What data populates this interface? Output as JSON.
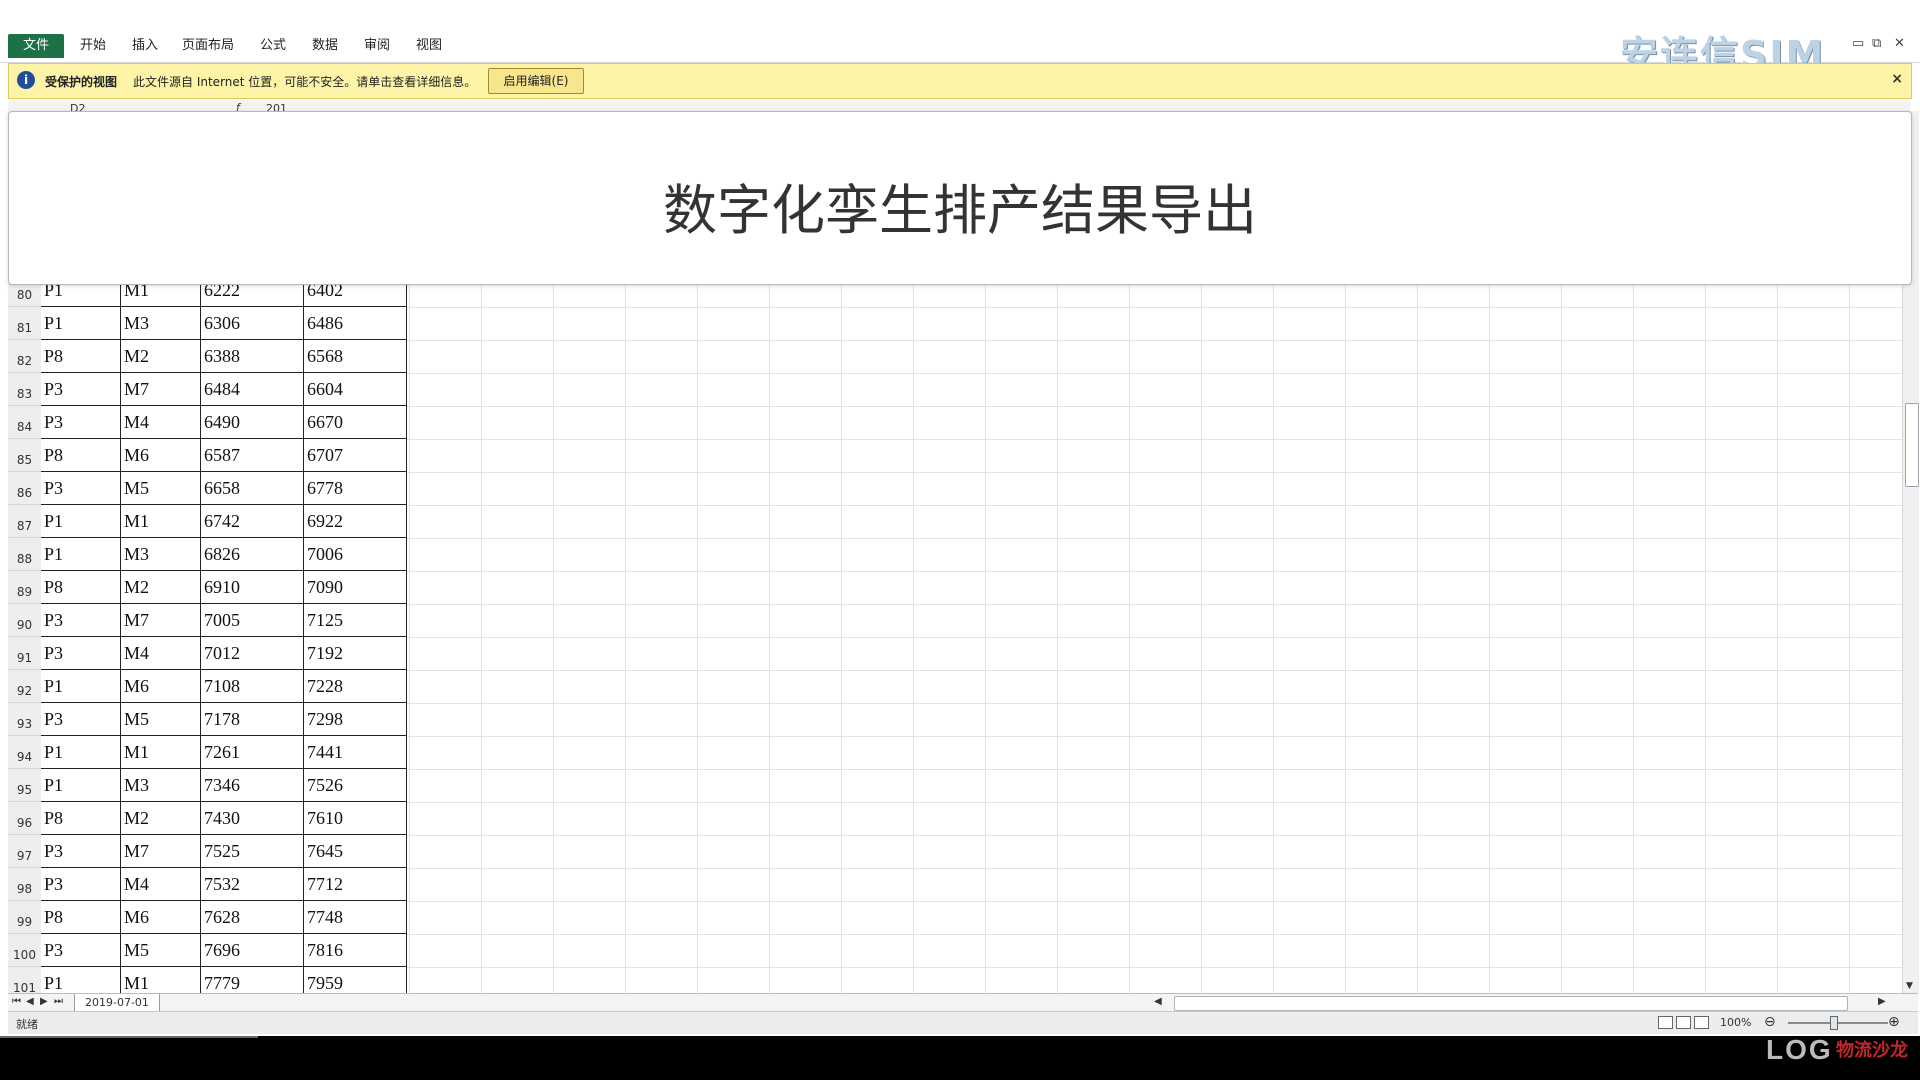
{
  "watermark": {
    "text": "安连信SIM"
  },
  "menu": {
    "tabs": [
      {
        "label": "文件"
      },
      {
        "label": "开始"
      },
      {
        "label": "插入"
      },
      {
        "label": "页面布局"
      },
      {
        "label": "公式"
      },
      {
        "label": "数据"
      },
      {
        "label": "审阅"
      },
      {
        "label": "视图"
      }
    ]
  },
  "protected_view": {
    "title": "受保护的视图",
    "message": "此文件源自 Internet 位置，可能不安全。请单击查看详细信息。",
    "enable_button": "启用编辑(E)",
    "close": "×"
  },
  "formula_bar": {
    "name_box": "D2",
    "fx": "f",
    "value": "201"
  },
  "overlay_title": "数字化孪生排产结果导出",
  "rows": [
    {
      "n": "80",
      "cells": [
        "P1",
        "M1",
        "6222",
        "6402"
      ]
    },
    {
      "n": "81",
      "cells": [
        "P1",
        "M3",
        "6306",
        "6486"
      ]
    },
    {
      "n": "82",
      "cells": [
        "P8",
        "M2",
        "6388",
        "6568"
      ]
    },
    {
      "n": "83",
      "cells": [
        "P3",
        "M7",
        "6484",
        "6604"
      ]
    },
    {
      "n": "84",
      "cells": [
        "P3",
        "M4",
        "6490",
        "6670"
      ]
    },
    {
      "n": "85",
      "cells": [
        "P8",
        "M6",
        "6587",
        "6707"
      ]
    },
    {
      "n": "86",
      "cells": [
        "P3",
        "M5",
        "6658",
        "6778"
      ]
    },
    {
      "n": "87",
      "cells": [
        "P1",
        "M1",
        "6742",
        "6922"
      ]
    },
    {
      "n": "88",
      "cells": [
        "P1",
        "M3",
        "6826",
        "7006"
      ]
    },
    {
      "n": "89",
      "cells": [
        "P8",
        "M2",
        "6910",
        "7090"
      ]
    },
    {
      "n": "90",
      "cells": [
        "P3",
        "M7",
        "7005",
        "7125"
      ]
    },
    {
      "n": "91",
      "cells": [
        "P3",
        "M4",
        "7012",
        "7192"
      ]
    },
    {
      "n": "92",
      "cells": [
        "P1",
        "M6",
        "7108",
        "7228"
      ]
    },
    {
      "n": "93",
      "cells": [
        "P3",
        "M5",
        "7178",
        "7298"
      ]
    },
    {
      "n": "94",
      "cells": [
        "P1",
        "M1",
        "7261",
        "7441"
      ]
    },
    {
      "n": "95",
      "cells": [
        "P1",
        "M3",
        "7346",
        "7526"
      ]
    },
    {
      "n": "96",
      "cells": [
        "P8",
        "M2",
        "7430",
        "7610"
      ]
    },
    {
      "n": "97",
      "cells": [
        "P3",
        "M7",
        "7525",
        "7645"
      ]
    },
    {
      "n": "98",
      "cells": [
        "P3",
        "M4",
        "7532",
        "7712"
      ]
    },
    {
      "n": "99",
      "cells": [
        "P8",
        "M6",
        "7628",
        "7748"
      ]
    },
    {
      "n": "100",
      "cells": [
        "P3",
        "M5",
        "7696",
        "7816"
      ]
    },
    {
      "n": "101",
      "cells": [
        "P1",
        "M1",
        "7779",
        "7959"
      ]
    }
  ],
  "sheet_tab": "2019-07-01",
  "status": {
    "ready": "就绪",
    "zoom": "100%"
  },
  "logo": {
    "latin": "LOG",
    "chinese": "物流沙龙"
  }
}
